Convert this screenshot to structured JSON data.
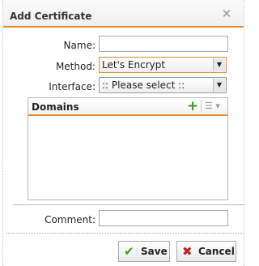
{
  "dialog": {
    "title": "Add Certificate",
    "close_icon": "close-icon"
  },
  "form": {
    "name_label": "Name:",
    "name_value": "",
    "method_label": "Method:",
    "method_value": "Let's Encrypt",
    "interface_label": "Interface:",
    "interface_value": ":: Please select ::",
    "comment_label": "Comment:",
    "comment_value": ""
  },
  "domains": {
    "header": "Domains",
    "add_icon": "plus-icon",
    "menu_icon": "list-menu-icon",
    "rows": []
  },
  "buttons": {
    "save_label": "Save",
    "cancel_label": "Cancel"
  },
  "colors": {
    "accent": "#e0902a",
    "save_icon": "#3a9a1a",
    "cancel_icon": "#c82020"
  }
}
